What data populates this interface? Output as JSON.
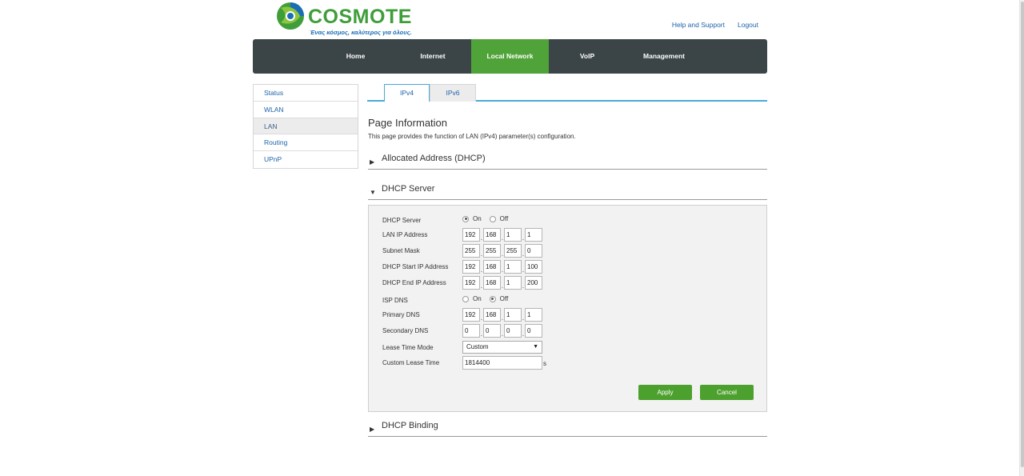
{
  "brand": {
    "name": "COSMOTE",
    "tagline": "Ένας κόσμος, καλύτερος για όλους.",
    "colors": {
      "green": "#3f9e3a",
      "blue": "#1a6db5"
    }
  },
  "top_links": {
    "help": "Help and Support",
    "logout": "Logout"
  },
  "nav": {
    "items": [
      "Home",
      "Internet",
      "Local Network",
      "VoIP",
      "Management"
    ],
    "active": "Local Network",
    "colors": {
      "bar": "#3b4446",
      "active": "#4fa338"
    }
  },
  "sidebar": {
    "items": [
      "Status",
      "WLAN",
      "LAN",
      "Routing",
      "UPnP"
    ],
    "active": "LAN"
  },
  "tabs": {
    "items": [
      "IPv4",
      "IPv6"
    ],
    "active": "IPv4"
  },
  "page": {
    "title": "Page Information",
    "description": "This page provides the function of LAN (IPv4) parameter(s) configuration."
  },
  "sections": {
    "allocated": "Allocated Address (DHCP)",
    "dhcp_server": "DHCP Server",
    "dhcp_binding": "DHCP Binding"
  },
  "form": {
    "dhcp_server": {
      "label": "DHCP Server",
      "on": "On",
      "off": "Off",
      "value": "On"
    },
    "lan_ip": {
      "label": "LAN IP Address",
      "octets": [
        "192",
        "168",
        "1",
        "1"
      ]
    },
    "subnet_mask": {
      "label": "Subnet Mask",
      "octets": [
        "255",
        "255",
        "255",
        "0"
      ]
    },
    "start_ip": {
      "label": "DHCP Start IP Address",
      "octets": [
        "192",
        "168",
        "1",
        "100"
      ]
    },
    "end_ip": {
      "label": "DHCP End IP Address",
      "octets": [
        "192",
        "168",
        "1",
        "200"
      ]
    },
    "isp_dns": {
      "label": "ISP DNS",
      "on": "On",
      "off": "Off",
      "value": "Off"
    },
    "primary_dns": {
      "label": "Primary DNS",
      "octets": [
        "192",
        "168",
        "1",
        "1"
      ]
    },
    "secondary_dns": {
      "label": "Secondary DNS",
      "octets": [
        "0",
        "0",
        "0",
        "0"
      ]
    },
    "lease_mode": {
      "label": "Lease Time Mode",
      "value": "Custom"
    },
    "custom_lease": {
      "label": "Custom Lease Time",
      "value": "1814400",
      "unit": "s"
    }
  },
  "buttons": {
    "apply": "Apply",
    "cancel": "Cancel",
    "color": "#4ca02d"
  }
}
